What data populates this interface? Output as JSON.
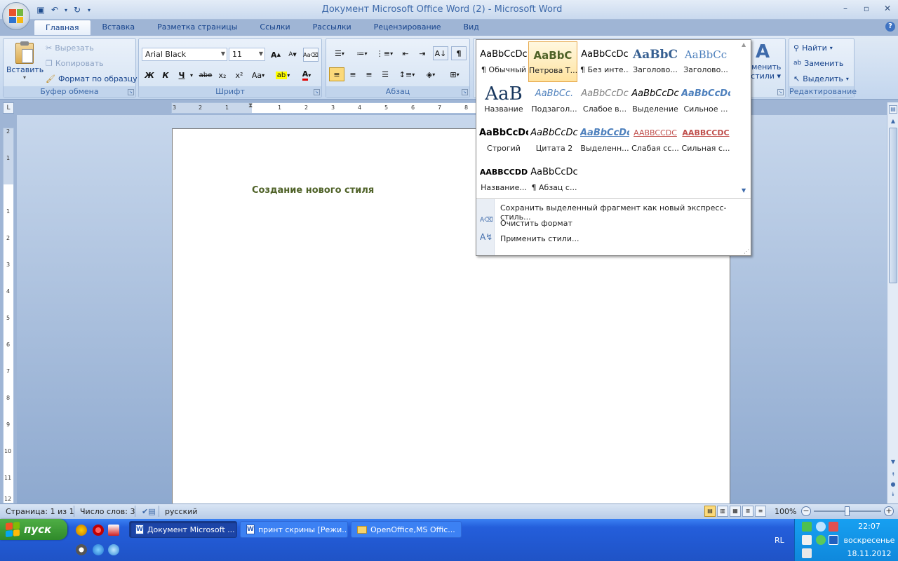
{
  "window": {
    "title": "Документ Microsoft Office Word (2) - Microsoft Word"
  },
  "ribbon": {
    "tabs": [
      "Главная",
      "Вставка",
      "Разметка страницы",
      "Ссылки",
      "Рассылки",
      "Рецензирование",
      "Вид"
    ],
    "clipboard": {
      "paste": "Вставить",
      "cut": "Вырезать",
      "copy": "Копировать",
      "format_painter": "Формат по образцу",
      "label": "Буфер обмена"
    },
    "font": {
      "name": "Arial Black",
      "size": "11",
      "label": "Шрифт",
      "bold": "Ж",
      "italic": "К",
      "underline": "Ч",
      "strike": "abe",
      "subscript": "x₂",
      "superscript": "x²",
      "case": "Aa"
    },
    "paragraph": {
      "label": "Абзац"
    },
    "styles": {
      "change_label_1": "Изменить",
      "change_label_2": "стили"
    },
    "editing": {
      "find": "Найти",
      "replace": "Заменить",
      "select": "Выделить",
      "label": "Редактирование"
    }
  },
  "gallery": {
    "styles": [
      {
        "preview": "AaBbCcDc",
        "name": "¶ Обычный"
      },
      {
        "preview": "AaBbC",
        "name": "Петрова Т..."
      },
      {
        "preview": "AaBbCcDc",
        "name": "¶ Без инте..."
      },
      {
        "preview": "AaBbC",
        "name": "Заголово..."
      },
      {
        "preview": "AaBbCc",
        "name": "Заголово..."
      },
      {
        "preview": "AaB",
        "name": "Название"
      },
      {
        "preview": "AaBbCc.",
        "name": "Подзагол..."
      },
      {
        "preview": "AaBbCcDc",
        "name": "Слабое в..."
      },
      {
        "preview": "AaBbCcDc",
        "name": "Выделение"
      },
      {
        "preview": "AaBbCcDc",
        "name": "Сильное ..."
      },
      {
        "preview": "AaBbCcDc",
        "name": "Строгий"
      },
      {
        "preview": "AaBbCcDc",
        "name": "Цитата 2"
      },
      {
        "preview": "AaBbCcDc",
        "name": "Выделенн..."
      },
      {
        "preview": "AABBCCDC",
        "name": "Слабая сс..."
      },
      {
        "preview": "AABBCCDC",
        "name": "Сильная с..."
      },
      {
        "preview": "AABBCCDD",
        "name": "Название..."
      },
      {
        "preview": "AaBbCcDc",
        "name": "¶ Абзац с..."
      }
    ],
    "menu": {
      "save_selection": "Сохранить выделенный фрагмент как новый экспресс-стиль...",
      "clear_format": "Очистить формат",
      "apply_styles": "Применить стили..."
    }
  },
  "ruler": {
    "h_left": [
      "3",
      "2",
      "1"
    ],
    "h_right": [
      "1",
      "2",
      "3",
      "4",
      "5",
      "6",
      "7",
      "8"
    ],
    "v_top": [
      "2",
      "1"
    ],
    "v_body": [
      "1",
      "2",
      "3",
      "4",
      "5",
      "6",
      "7",
      "8",
      "9",
      "10",
      "11",
      "12"
    ]
  },
  "document": {
    "heading": "Создание нового стиля"
  },
  "statusbar": {
    "page": "Страница: 1 из 1",
    "words": "Число слов: 3",
    "language": "русский",
    "zoom": "100%"
  },
  "taskbar": {
    "start": "пуск",
    "windows": [
      "Документ Microsoft ...",
      "принт скрины [Режи...",
      "OpenOffice,MS Offic..."
    ],
    "lang": "RL",
    "time": "22:07",
    "day": "воскресенье",
    "date": "18.11.2012"
  }
}
